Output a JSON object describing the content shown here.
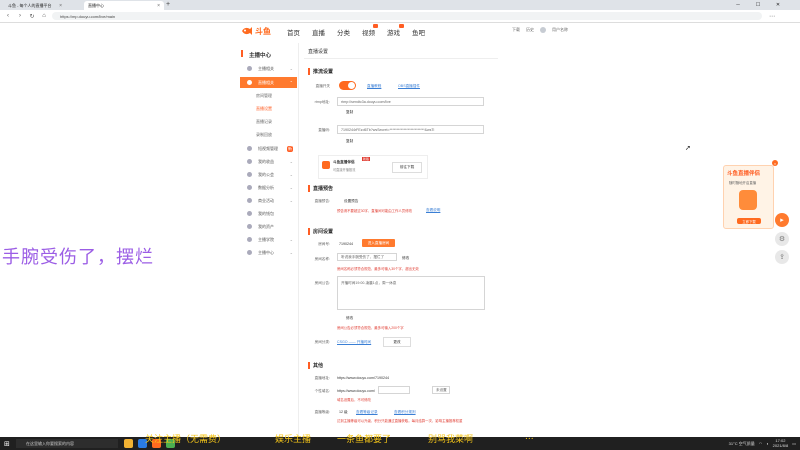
{
  "browser": {
    "tabs": [
      {
        "label": "斗鱼 - 每个人的直播平台"
      },
      {
        "label": "直播中心"
      }
    ],
    "new_tab": "+",
    "address": "https://mp.douyu.com/live/main",
    "win_min": "─",
    "win_max": "☐",
    "win_close": "✕"
  },
  "header": {
    "logo": "斗鱼",
    "nav": [
      "首页",
      "直播",
      "分类",
      "视频",
      "游戏",
      "鱼吧"
    ],
    "user_items": [
      "下载",
      "历史",
      "用户名称"
    ]
  },
  "sidebar": {
    "title": "主播中心",
    "items": [
      {
        "label": "主播相关"
      },
      {
        "label": "直播相关"
      },
      {
        "label": "短视频管理"
      },
      {
        "label": "我的收益"
      },
      {
        "label": "我的公会"
      },
      {
        "label": "数据分析"
      },
      {
        "label": "商业活动"
      },
      {
        "label": "我的钱包"
      },
      {
        "label": "我的资产"
      },
      {
        "label": "主播学院"
      },
      {
        "label": "主播中心"
      }
    ],
    "subs": [
      "房间管理",
      "直播设置",
      "直播记录",
      "录制回放"
    ]
  },
  "main": {
    "page_title": "直播设置",
    "push": {
      "section": "推流设置",
      "toggle_label": "直播开关",
      "link1": "直播教程",
      "link2": "OBS直播插件",
      "rtmp_label": "rtmp地址:",
      "rtmp_value": "rtmp://sendtc3a.douyu.com/live",
      "copy": "复制",
      "code_label": "直播码:",
      "code_value": "7190244rFEzd6Tb?wsSecret=*************************&wsTi",
      "copy2": "复制",
      "tool_name": "斗鱼直播伴侣",
      "tool_sub": "可直接开播推流",
      "tool_tag": "新版",
      "tool_btn": "前往下载"
    },
    "preview": {
      "section": "直播预告",
      "label": "直播预告:",
      "value": "设置预告",
      "note": "预告请不要超过30字，直播间可能由工作人员修改",
      "link": "查看说明"
    },
    "room": {
      "section": "房间设置",
      "id_label": "房间号:",
      "id_value": "7190244",
      "id_btn": "进入直播房间",
      "name_label": "房间名称:",
      "name_value": "听说我手腕受伤了，摆烂了",
      "name_btn": "修改",
      "name_note": "房间名称必须符合规范，最多可输入30个字，超出无效",
      "notice_label": "房间公告:",
      "notice_value": "开播时间19:00-凌晨1点，周一休息",
      "notice_btn": "修改",
      "notice_note": "房间公告必须符合规范，最多可输入200个字",
      "cat_label": "房间分类:",
      "cat_value": "CSGO —— 开播时间",
      "cat_btn": "更改"
    },
    "other": {
      "section": "其他",
      "url_label": "直播地址:",
      "url_value": "https://www.douyu.com/7190244",
      "person_label": "个性域名:",
      "person_value": "https://www.douyu.com/",
      "person_select": "未设置",
      "person_note": "域名设置后，不可修改",
      "level_label": "直播等级:",
      "level_value": "12 级",
      "level_link1": "查看等级记录",
      "level_link2": "查看积分规则",
      "level_note": "达到主播等级可以升级，积分只能通过直播获取。每月结算一次，影响主播推荐权重"
    }
  },
  "ad": {
    "title": "斗鱼直播伴侣",
    "sub": "随时随地开启直播",
    "btn": "立即下载"
  },
  "watermark": "手腕受伤了，摆烂",
  "danmu": [
    "关注主播（无需费）",
    "娱乐主播",
    "一条鱼都要了",
    "别骂我菜啊",
    "..."
  ],
  "taskbar": {
    "search": "在这里输入你要搜索的内容",
    "weather": "31°C 空气质量",
    "time": "17:02",
    "date": "2021/8/8"
  }
}
